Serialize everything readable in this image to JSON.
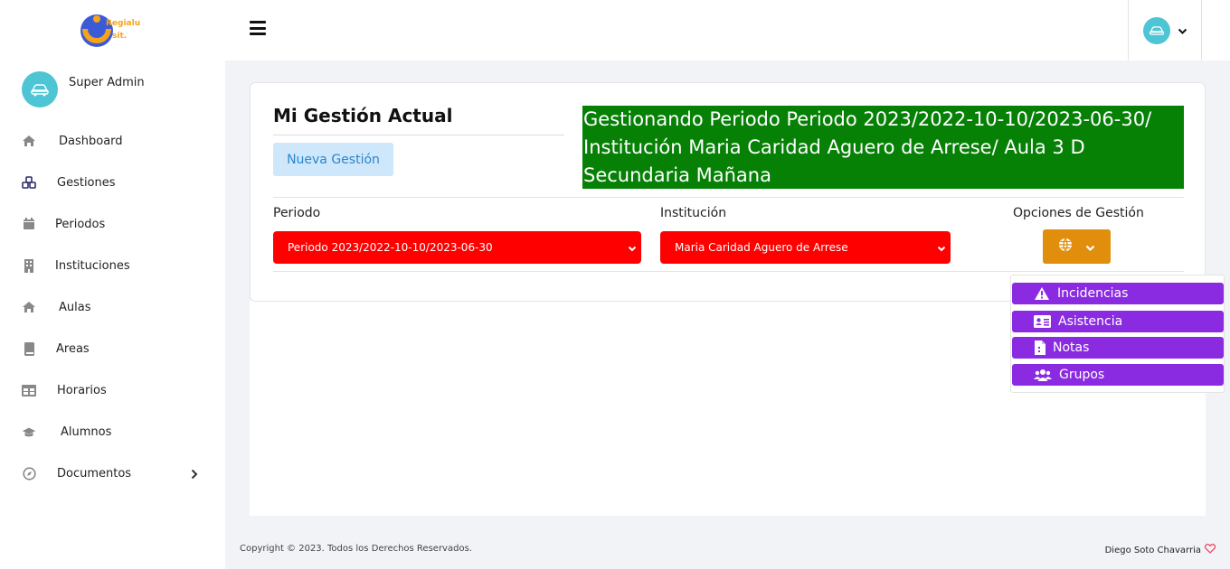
{
  "app": {
    "logo_text_1": "Regialu",
    "logo_text_2": "sit."
  },
  "sidebar": {
    "user_name": "Super Admin",
    "items": [
      {
        "label": "Dashboard",
        "icon": "home-icon"
      },
      {
        "label": "Gestiones",
        "icon": "cubes-icon"
      },
      {
        "label": "Periodos",
        "icon": "calendar-icon"
      },
      {
        "label": "Instituciones",
        "icon": "building-icon"
      },
      {
        "label": "Aulas",
        "icon": "home-icon"
      },
      {
        "label": "Areas",
        "icon": "book-icon"
      },
      {
        "label": "Horarios",
        "icon": "table-icon"
      },
      {
        "label": "Alumnos",
        "icon": "graduation-cap-icon"
      },
      {
        "label": "Documentos",
        "icon": "compass-icon",
        "has_submenu": true
      }
    ]
  },
  "card": {
    "title": "Mi Gestión Actual",
    "new_button": "Nueva Gestión",
    "status": "Gestionando Periodo Periodo 2023/2022-10-10/2023-06-30/ Institución Maria Caridad Aguero de Arrese/ Aula 3 D Secundaria Mañana",
    "periodo_label": "Periodo",
    "periodo_value": "Periodo 2023/2022-10-10/2023-06-30",
    "institucion_label": "Institución",
    "institucion_value": "Maria Caridad Aguero de Arrese",
    "opciones_label": "Opciones de Gestión"
  },
  "menu": {
    "items": [
      {
        "label": "Incidencias",
        "icon": "warning-icon"
      },
      {
        "label": "Asistencia",
        "icon": "id-card-icon"
      },
      {
        "label": "Notas",
        "icon": "file-icon"
      },
      {
        "label": "Grupos",
        "icon": "users-icon"
      }
    ]
  },
  "footer": {
    "copyright": "Copyright © 2023. Todos los Derechos Reservados.",
    "author": "Diego Soto Chavarria"
  },
  "colors": {
    "accent_status": "#068106",
    "select_bg": "#ff0000",
    "options_button": "#e08e0b",
    "menu_item": "#8a2be2",
    "avatar": "#4ec5d4"
  }
}
